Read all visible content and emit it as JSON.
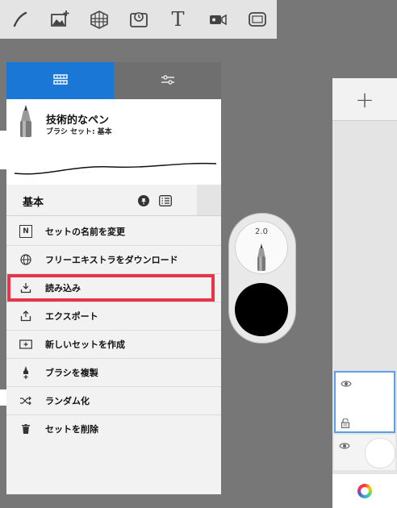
{
  "toolbar": {
    "tools": [
      "stroke-tool-icon",
      "image-add-icon",
      "perspective-grid-icon",
      "time-lapse-icon",
      "text-tool-icon",
      "video-icon",
      "frame-icon"
    ],
    "text_tool_glyph": "T"
  },
  "brush_panel": {
    "tabs": [
      "brush-library-icon",
      "brush-settings-icon"
    ],
    "active_tab": 0,
    "brush_name": "技術的なペン",
    "brush_set_line": "ブラシ セット: 基本",
    "set_name": "基本",
    "menu": [
      {
        "icon": "rename-icon",
        "icon_glyph": "N",
        "label": "セットの名前を変更"
      },
      {
        "icon": "globe-icon",
        "label": "フリーエキストラをダウンロード"
      },
      {
        "icon": "import-icon",
        "label": "読み込み",
        "highlighted": true
      },
      {
        "icon": "export-icon",
        "label": "エクスポート"
      },
      {
        "icon": "new-set-icon",
        "label": "新しいセットを作成"
      },
      {
        "icon": "duplicate-brush-icon",
        "label": "ブラシを複製"
      },
      {
        "icon": "shuffle-icon",
        "label": "ランダム化"
      },
      {
        "icon": "trash-icon",
        "label": "セットを削除"
      }
    ]
  },
  "puck": {
    "brush_size": "2.0",
    "color": "#000000"
  },
  "layers": {
    "add_label": "+"
  },
  "colors": {
    "accent": "#1a77d6",
    "highlight": "#e83449"
  }
}
